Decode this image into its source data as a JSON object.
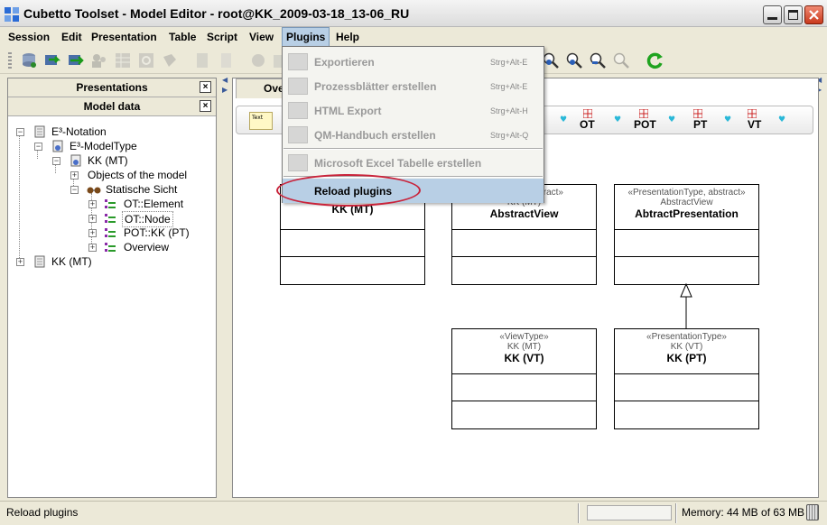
{
  "window": {
    "title": "Cubetto Toolset - Model Editor - root@KK_2009-03-18_13-06_RU"
  },
  "menubar": [
    {
      "label": "Session"
    },
    {
      "label": "Edit"
    },
    {
      "label": "Presentation"
    },
    {
      "label": "Table"
    },
    {
      "label": "Script"
    },
    {
      "label": "View"
    },
    {
      "label": "Plugins"
    },
    {
      "label": "Help"
    }
  ],
  "plugins_menu": {
    "items": [
      {
        "label": "Exportieren",
        "accelerator": "Strg+Alt-E",
        "enabled": false
      },
      {
        "label": "Prozessblätter erstellen",
        "accelerator": "Strg+Alt-E",
        "enabled": false
      },
      {
        "label": "HTML Export",
        "accelerator": "Strg+Alt-H",
        "enabled": false
      },
      {
        "label": "QM-Handbuch erstellen",
        "accelerator": "Strg+Alt-Q",
        "enabled": false
      },
      {
        "label": "Microsoft Excel Tabelle erstellen",
        "accelerator": "",
        "enabled": false
      },
      {
        "label": "Reload plugins",
        "accelerator": "",
        "enabled": true,
        "highlighted": true
      }
    ]
  },
  "left_panel": {
    "tabs": [
      {
        "label": "Presentations"
      },
      {
        "label": "Model data"
      }
    ],
    "close_symbol": "×",
    "tree": [
      {
        "label": "E³-Notation",
        "expand": "−"
      },
      {
        "label": "E³-ModelType",
        "expand": "−"
      },
      {
        "label": "KK (MT)",
        "expand": "−"
      },
      {
        "label": "Objects of the model",
        "expand": "+"
      },
      {
        "label": "Statische Sicht",
        "expand": "−"
      },
      {
        "label": "OT::Element",
        "expand": "+"
      },
      {
        "label": "OT::Node",
        "expand": "+"
      },
      {
        "label": "POT::KK (PT)",
        "expand": "+"
      },
      {
        "label": "Overview",
        "expand": "+"
      },
      {
        "label": "KK (MT)",
        "expand": "+"
      }
    ]
  },
  "right_panel": {
    "tab_label": "Ove",
    "palette": {
      "note_label": "Text",
      "items": [
        {
          "label": "OT"
        },
        {
          "label": "POT"
        },
        {
          "label": "PT"
        },
        {
          "label": "VT"
        }
      ]
    },
    "diagram": {
      "boxes": [
        {
          "stereotype": "",
          "meta": "",
          "name": "KK (MT)"
        },
        {
          "stereotype": "stract»",
          "meta": "KK (MT)",
          "name": "AbstractView"
        },
        {
          "stereotype": "«PresentationType, abstract»",
          "meta": "AbstractView",
          "name": "AbtractPresentation"
        },
        {
          "stereotype": "«ViewType»",
          "meta": "KK (MT)",
          "name": "KK (VT)"
        },
        {
          "stereotype": "«PresentationType»",
          "meta": "KK (VT)",
          "name": "KK (PT)"
        }
      ]
    }
  },
  "statusbar": {
    "message": "Reload plugins",
    "memory": "Memory: 44 MB of 63 MB"
  },
  "colors": {
    "menu_highlight": "#b8cfe5",
    "annotation_ellipse": "#c9233a",
    "refresh_green": "#1fa31f"
  }
}
